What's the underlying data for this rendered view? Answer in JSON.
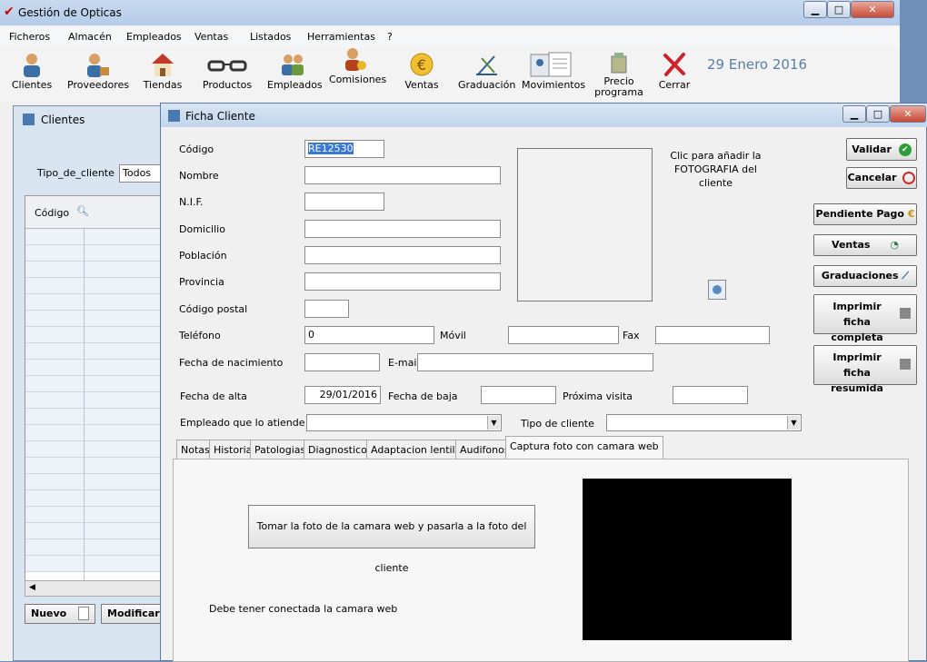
{
  "app": {
    "title": "Gestión de Opticas",
    "menu": [
      "Ficheros",
      "Almacén",
      "Empleados",
      "Ventas",
      "Listados",
      "Herramientas",
      "?"
    ],
    "toolbar": [
      {
        "label": "Clientes",
        "icon": "person-icon"
      },
      {
        "label": "Proveedores",
        "icon": "supplier-icon"
      },
      {
        "label": "Tiendas",
        "icon": "store-icon"
      },
      {
        "label": "Productos",
        "icon": "glasses-icon"
      },
      {
        "label": "Empleados",
        "icon": "employees-icon"
      },
      {
        "label": "Comisiones",
        "icon": "commission-icon"
      },
      {
        "label": "Ventas",
        "icon": "euro-icon"
      },
      {
        "label": "Graduación",
        "icon": "graduation-icon"
      },
      {
        "label": "Movimientos",
        "icon": "movements-icon"
      },
      {
        "label": "Precio programa",
        "icon": "price-icon"
      },
      {
        "label": "Cerrar",
        "icon": "close-x-icon"
      }
    ],
    "date": "29 Enero 2016"
  },
  "clientes": {
    "title": "Clientes",
    "tipo_label": "Tipo_de_cliente",
    "tipo_value": "Todos",
    "col_codigo": "Código",
    "btn_nuevo": "Nuevo",
    "btn_modificar": "Modificar"
  },
  "ficha": {
    "title": "Ficha Cliente",
    "labels": {
      "codigo": "Código",
      "nombre": "Nombre",
      "nif": "N.I.F.",
      "domicilio": "Domicilio",
      "poblacion": "Población",
      "provincia": "Provincia",
      "cp": "Código postal",
      "telefono": "Teléfono",
      "movil": "Móvil",
      "fax": "Fax",
      "nacimiento": "Fecha de nacimiento",
      "email": "E-mail",
      "alta": "Fecha de alta",
      "baja": "Fecha de baja",
      "proxima": "Próxima visita",
      "empleado": "Empleado que lo atiende",
      "tipo": "Tipo de cliente"
    },
    "values": {
      "codigo": "RE12530",
      "telefono": "0",
      "alta": "29/01/2016"
    },
    "photo_hint": "Clic para añadir la FOTOGRAFIA del cliente",
    "buttons": {
      "validar": "Validar",
      "cancelar": "Cancelar",
      "pendiente": "Pendiente Pago",
      "ventas": "Ventas",
      "graduaciones": "Graduaciones",
      "imprimir_completa": "Imprimir ficha completa",
      "imprimir_resumida": "Imprimir ficha resumida"
    },
    "tabs": [
      "Notas",
      "Historial",
      "Patologias",
      "Diagnosticos",
      "Adaptacion lentillas",
      "Audifonos",
      "Captura foto con camara web"
    ],
    "cam_button": "Tomar la foto de la camara web y pasarla a la foto del cliente",
    "cam_note": "Debe tener conectada la camara web"
  }
}
